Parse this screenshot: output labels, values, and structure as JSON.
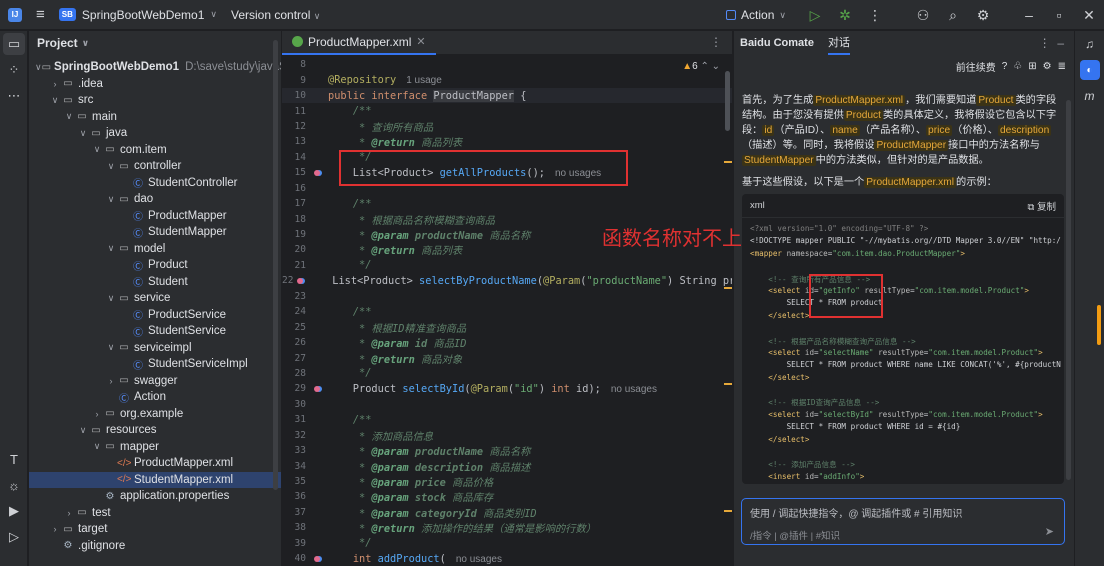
{
  "titlebar": {
    "project_badge": "SB",
    "project_name": "SpringBootWebDemo1",
    "version_control": "Version control",
    "action": "Action"
  },
  "project_panel": {
    "title": "Project",
    "tree": [
      {
        "label": "SpringBootWebDemo1",
        "extra": "D:\\save\\study\\javaStu\\Spri",
        "indent": 0,
        "chev": "∨",
        "icon": "folder",
        "bold": true
      },
      {
        "label": ".idea",
        "indent": 1,
        "chev": "›",
        "icon": "folder"
      },
      {
        "label": "src",
        "indent": 1,
        "chev": "∨",
        "icon": "folder"
      },
      {
        "label": "main",
        "indent": 2,
        "chev": "∨",
        "icon": "folder"
      },
      {
        "label": "java",
        "indent": 3,
        "chev": "∨",
        "icon": "folder"
      },
      {
        "label": "com.item",
        "indent": 4,
        "chev": "∨",
        "icon": "folder"
      },
      {
        "label": "controller",
        "indent": 5,
        "chev": "∨",
        "icon": "folder"
      },
      {
        "label": "StudentController",
        "indent": 6,
        "chev": "",
        "icon": "cls"
      },
      {
        "label": "dao",
        "indent": 5,
        "chev": "∨",
        "icon": "folder"
      },
      {
        "label": "ProductMapper",
        "indent": 6,
        "chev": "",
        "icon": "cls"
      },
      {
        "label": "StudentMapper",
        "indent": 6,
        "chev": "",
        "icon": "cls"
      },
      {
        "label": "model",
        "indent": 5,
        "chev": "∨",
        "icon": "folder"
      },
      {
        "label": "Product",
        "indent": 6,
        "chev": "",
        "icon": "cls"
      },
      {
        "label": "Student",
        "indent": 6,
        "chev": "",
        "icon": "cls"
      },
      {
        "label": "service",
        "indent": 5,
        "chev": "∨",
        "icon": "folder"
      },
      {
        "label": "ProductService",
        "indent": 6,
        "chev": "",
        "icon": "cls"
      },
      {
        "label": "StudentService",
        "indent": 6,
        "chev": "",
        "icon": "cls"
      },
      {
        "label": "serviceimpl",
        "indent": 5,
        "chev": "∨",
        "icon": "folder"
      },
      {
        "label": "StudentServiceImpl",
        "indent": 6,
        "chev": "",
        "icon": "cls"
      },
      {
        "label": "swagger",
        "indent": 5,
        "chev": "›",
        "icon": "folder"
      },
      {
        "label": "Action",
        "indent": 5,
        "chev": "",
        "icon": "cls"
      },
      {
        "label": "org.example",
        "indent": 4,
        "chev": "›",
        "icon": "folder"
      },
      {
        "label": "resources",
        "indent": 3,
        "chev": "∨",
        "icon": "folder"
      },
      {
        "label": "mapper",
        "indent": 4,
        "chev": "∨",
        "icon": "folder"
      },
      {
        "label": "ProductMapper.xml",
        "indent": 5,
        "chev": "",
        "icon": "xml"
      },
      {
        "label": "StudentMapper.xml",
        "indent": 5,
        "chev": "",
        "icon": "xml",
        "selected": true
      },
      {
        "label": "application.properties",
        "indent": 4,
        "chev": "",
        "icon": "prop"
      },
      {
        "label": "test",
        "indent": 2,
        "chev": "›",
        "icon": "folder"
      },
      {
        "label": "target",
        "indent": 1,
        "chev": "›",
        "icon": "folder"
      },
      {
        "label": ".gitignore",
        "indent": 1,
        "chev": "",
        "icon": "prop"
      }
    ]
  },
  "editor": {
    "tab": "ProductMapper.xml",
    "warnings": "6",
    "annotation_text": "函数名称对不上",
    "lines": [
      {
        "n": "8",
        "html": ""
      },
      {
        "n": "9",
        "html": "<span class='ann'>@Repository</span><span class='hint'>1 usage</span>"
      },
      {
        "n": "10",
        "html": "<span class='kw'>public interface</span> <span class='hl'>ProductMapper</span> {"
      },
      {
        "n": "11",
        "html": "    <span class='cmt'>/**</span>"
      },
      {
        "n": "12",
        "html": "    <span class='cmt'> * 查询所有商品</span>"
      },
      {
        "n": "13",
        "html": "    <span class='cmt'> * <span class='cmt-tag'>@return</span> 商品列表</span>"
      },
      {
        "n": "14",
        "html": "    <span class='cmt'> */</span>"
      },
      {
        "n": "15",
        "g": true,
        "html": "    List&lt;Product&gt; <span class='fn'>getAllProducts</span>();<span class='hint'>no usages</span>"
      },
      {
        "n": "16",
        "html": ""
      },
      {
        "n": "17",
        "html": "    <span class='cmt'>/**</span>"
      },
      {
        "n": "18",
        "html": "    <span class='cmt'> * 根据商品名称模糊查询商品</span>"
      },
      {
        "n": "19",
        "html": "    <span class='cmt'> * <span class='cmt-tag'>@param</span> <b>productName</b> 商品名称</span>"
      },
      {
        "n": "20",
        "html": "    <span class='cmt'> * <span class='cmt-tag'>@return</span> 商品列表</span>"
      },
      {
        "n": "21",
        "html": "    <span class='cmt'> */</span>"
      },
      {
        "n": "22",
        "g": true,
        "html": "    List&lt;Product&gt; <span class='fn'>selectByProductName</span>(<span class='ann'>@Param</span>(<span class='str'>\"productName\"</span>) String produc"
      },
      {
        "n": "23",
        "html": ""
      },
      {
        "n": "24",
        "html": "    <span class='cmt'>/**</span>"
      },
      {
        "n": "25",
        "html": "    <span class='cmt'> * 根据ID精准查询商品</span>"
      },
      {
        "n": "26",
        "html": "    <span class='cmt'> * <span class='cmt-tag'>@param</span> <b>id</b> 商品ID</span>"
      },
      {
        "n": "27",
        "html": "    <span class='cmt'> * <span class='cmt-tag'>@return</span> 商品对象</span>"
      },
      {
        "n": "28",
        "html": "    <span class='cmt'> */</span>"
      },
      {
        "n": "29",
        "g": true,
        "html": "    Product <span class='fn'>selectById</span>(<span class='ann'>@Param</span>(<span class='str'>\"id\"</span>) <span class='kw'>int</span> id);<span class='hint'>no usages</span>"
      },
      {
        "n": "30",
        "html": ""
      },
      {
        "n": "31",
        "html": "    <span class='cmt'>/**</span>"
      },
      {
        "n": "32",
        "html": "    <span class='cmt'> * 添加商品信息</span>"
      },
      {
        "n": "33",
        "html": "    <span class='cmt'> * <span class='cmt-tag'>@param</span> <b>productName</b> 商品名称</span>"
      },
      {
        "n": "34",
        "html": "    <span class='cmt'> * <span class='cmt-tag'>@param</span> <b>description</b> 商品描述</span>"
      },
      {
        "n": "35",
        "html": "    <span class='cmt'> * <span class='cmt-tag'>@param</span> <b>price</b> 商品价格</span>"
      },
      {
        "n": "36",
        "html": "    <span class='cmt'> * <span class='cmt-tag'>@param</span> <b>stock</b> 商品库存</span>"
      },
      {
        "n": "37",
        "html": "    <span class='cmt'> * <span class='cmt-tag'>@param</span> <b>categoryId</b> 商品类别ID</span>"
      },
      {
        "n": "38",
        "html": "    <span class='cmt'> * <span class='cmt-tag'>@return</span> 添加操作的结果（通常是影响的行数）</span>"
      },
      {
        "n": "39",
        "html": "    <span class='cmt'> */</span>"
      },
      {
        "n": "40",
        "g": true,
        "html": "    <span class='kw'>int</span> <span class='fn'>addProduct</span>(<span class='hint'>no usages</span>"
      }
    ]
  },
  "comate": {
    "title": "Baidu Comate",
    "tab": "对话",
    "subhead": "前往续费",
    "para1": "首先，为了生成<span class='tag'>ProductMapper.xml</span>，我们需要知道<span class='tag'>Product</span>类的字段结构。由于您没有提供<span class='tag'>Product</span>类的具体定义，我将假设它包含以下字段：<span class='tag'>id</span>（产品ID）、<span class='tag'>name</span>（产品名称）、<span class='tag'>price</span>（价格）、<span class='tag'>description</span>（描述）等。同时，我将假设<span class='tag'>ProductMapper</span>接口中的方法名称与<span class='tag'>StudentMapper</span>中的方法类似，但针对的是产品数据。",
    "para2": "基于这些假设，以下是一个<span class='tag'>ProductMapper.xml</span>的示例：",
    "code_lang": "xml",
    "copy_label": "复制",
    "code_lines": [
      "<span class='x-gray'>&lt;?xml version=\"1.0\" encoding=\"UTF-8\" ?&gt;</span>",
      "&lt;!DOCTYPE mapper PUBLIC \"-//mybatis.org//DTD Mapper 3.0//EN\" \"http:/",
      "<span class='x-kw'>&lt;mapper</span> <span class='x-attr'>namespace</span>=<span class='x-val'>\"com.item.dao.ProductMapper\"</span><span class='x-kw'>&gt;</span>",
      "",
      "    <span class='x-cmt'>&lt;!-- 查询所有产品信息 --&gt;</span>",
      "    <span class='x-kw'>&lt;select</span> <span class='x-attr'>id</span>=<span class='x-val'>\"getInfo\"</span> <span class='x-attr'>resultType</span>=<span class='x-val'>\"com.item.model.Product\"</span><span class='x-kw'>&gt;</span>",
      "        SELECT * FROM product",
      "    <span class='x-kw'>&lt;/select&gt;</span>",
      "",
      "    <span class='x-cmt'>&lt;!-- 根据产品名称模糊查询产品信息 --&gt;</span>",
      "    <span class='x-kw'>&lt;select</span> <span class='x-attr'>id</span>=<span class='x-val'>\"selectName\"</span> <span class='x-attr'>resultType</span>=<span class='x-val'>\"com.item.model.Product\"</span><span class='x-kw'>&gt;</span>",
      "        SELECT * FROM product WHERE name LIKE CONCAT('%', #{productN",
      "    <span class='x-kw'>&lt;/select&gt;</span>",
      "",
      "    <span class='x-cmt'>&lt;!-- 根据ID查询产品信息 --&gt;</span>",
      "    <span class='x-kw'>&lt;select</span> <span class='x-attr'>id</span>=<span class='x-val'>\"selectById\"</span> <span class='x-attr'>resultType</span>=<span class='x-val'>\"com.item.model.Product\"</span><span class='x-kw'>&gt;</span>",
      "        SELECT * FROM product WHERE id = #{id}",
      "    <span class='x-kw'>&lt;/select&gt;</span>",
      "",
      "    <span class='x-cmt'>&lt;!-- 添加产品信息 --&gt;</span>",
      "    <span class='x-kw'>&lt;insert</span> <span class='x-attr'>id</span>=<span class='x-val'>\"addInfo\"</span><span class='x-kw'>&gt;</span>"
    ],
    "input_placeholder": "使用 / 调起快捷指令，@ 调起插件或 # 引用知识",
    "input_tools": "/指令 | @插件 | #知识"
  }
}
